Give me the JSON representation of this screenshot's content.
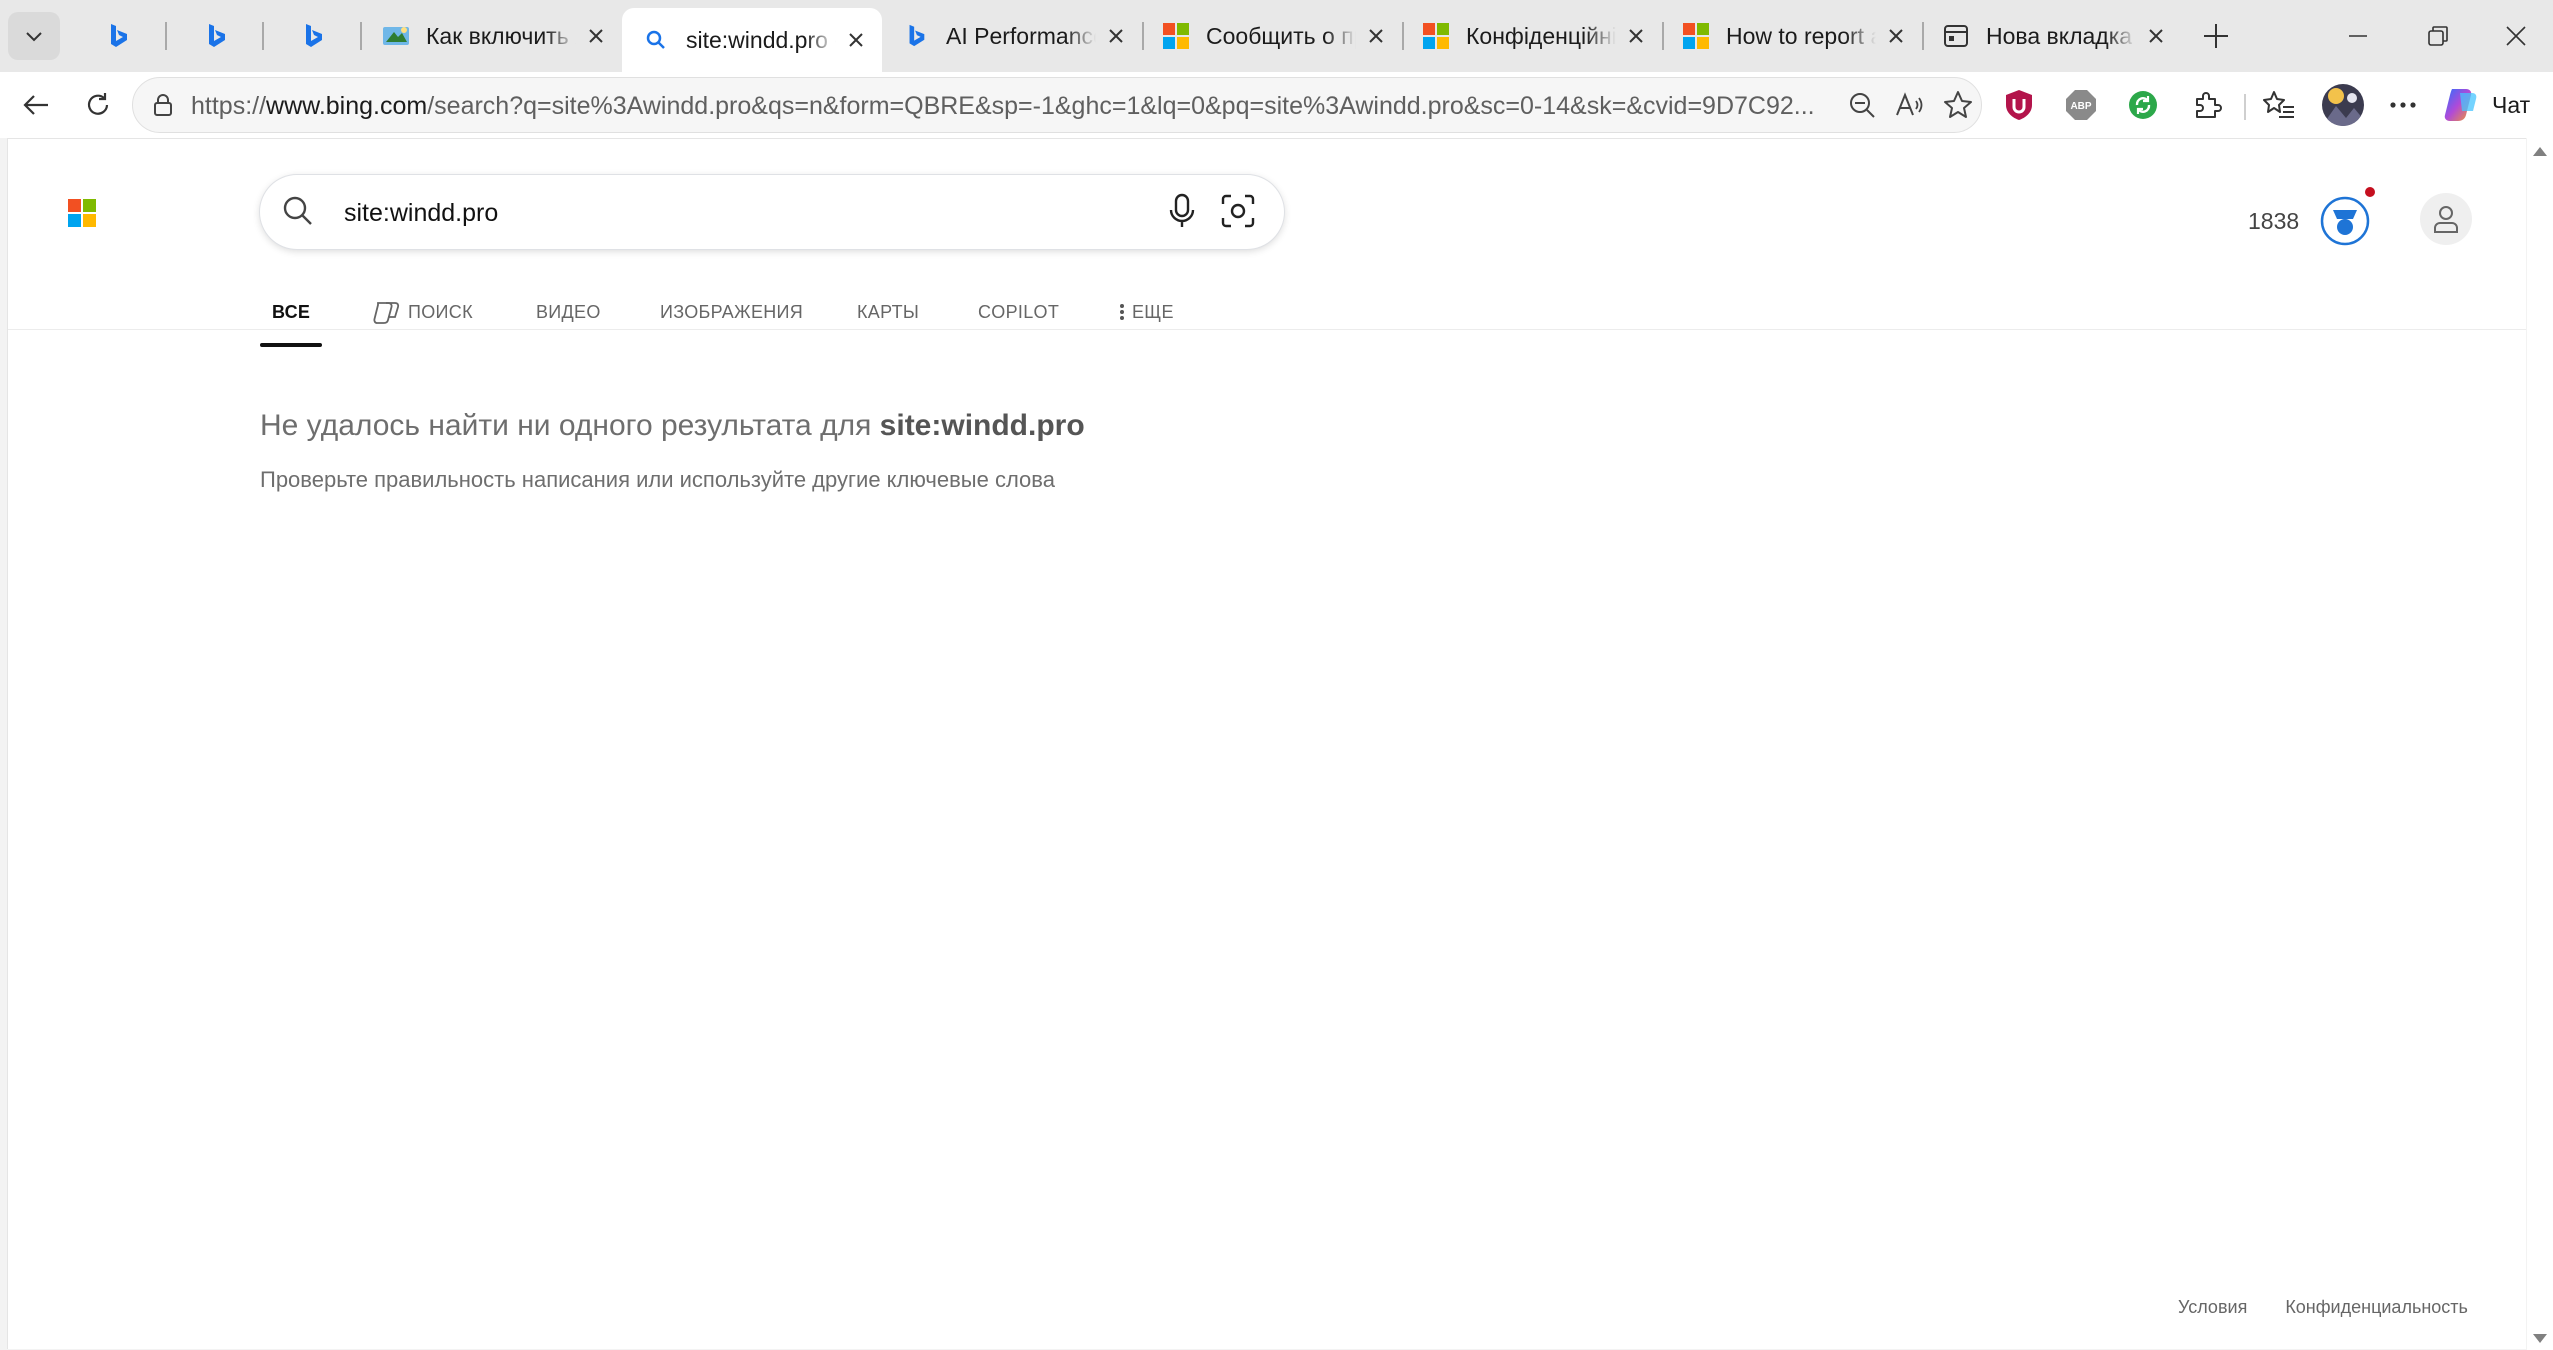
{
  "tabs": [
    {
      "kind": "pinned",
      "icon": "bing-icon"
    },
    {
      "kind": "pinned",
      "icon": "bing-icon"
    },
    {
      "kind": "pinned",
      "icon": "bing-icon"
    },
    {
      "title": "Как включить AI Performance",
      "icon": "windows-site-icon"
    },
    {
      "title": "site:windd.pro - Поиск",
      "icon": "search-icon",
      "active": true
    },
    {
      "title": "AI Performance - Поиск",
      "icon": "bing-icon"
    },
    {
      "title": "Сообщить о проблеме",
      "icon": "microsoft-logo-icon"
    },
    {
      "title": "Конфіденційність",
      "icon": "microsoft-logo-icon"
    },
    {
      "title": "How to report a concern",
      "icon": "microsoft-logo-icon"
    },
    {
      "title": "Нова вкладка",
      "icon": "new-tab-page-icon"
    }
  ],
  "address": {
    "scheme": "https://",
    "host": "www.bing.com",
    "path": "/search?q=site%3Awindd.pro&qs=n&form=QBRE&sp=-1&ghc=1&lq=0&pq=site%3Awindd.pro&sc=0-14&sk=&cvid=9D7C92..."
  },
  "copilot": {
    "label": "Чат"
  },
  "search": {
    "query": "site:windd.pro"
  },
  "rewards": {
    "points": "1838"
  },
  "scopes": [
    "ВСЕ",
    "ПОИСК",
    "ВИДЕО",
    "ИЗОБРАЖЕНИЯ",
    "КАРТЫ",
    "COPILOT",
    "ЕЩЕ"
  ],
  "results": {
    "message_prefix": "Не удалось найти ни одного результата для",
    "message_query": "site:windd.pro",
    "suggestion": "Проверьте правильность написания или используйте другие ключевые слова"
  },
  "footer": {
    "terms": "Условия",
    "privacy": "Конфиденциальность"
  },
  "colors": {
    "bing_blue": "#1a73e8",
    "rewards_blue": "#1e74d6",
    "accent_red": "#c50f1f"
  }
}
